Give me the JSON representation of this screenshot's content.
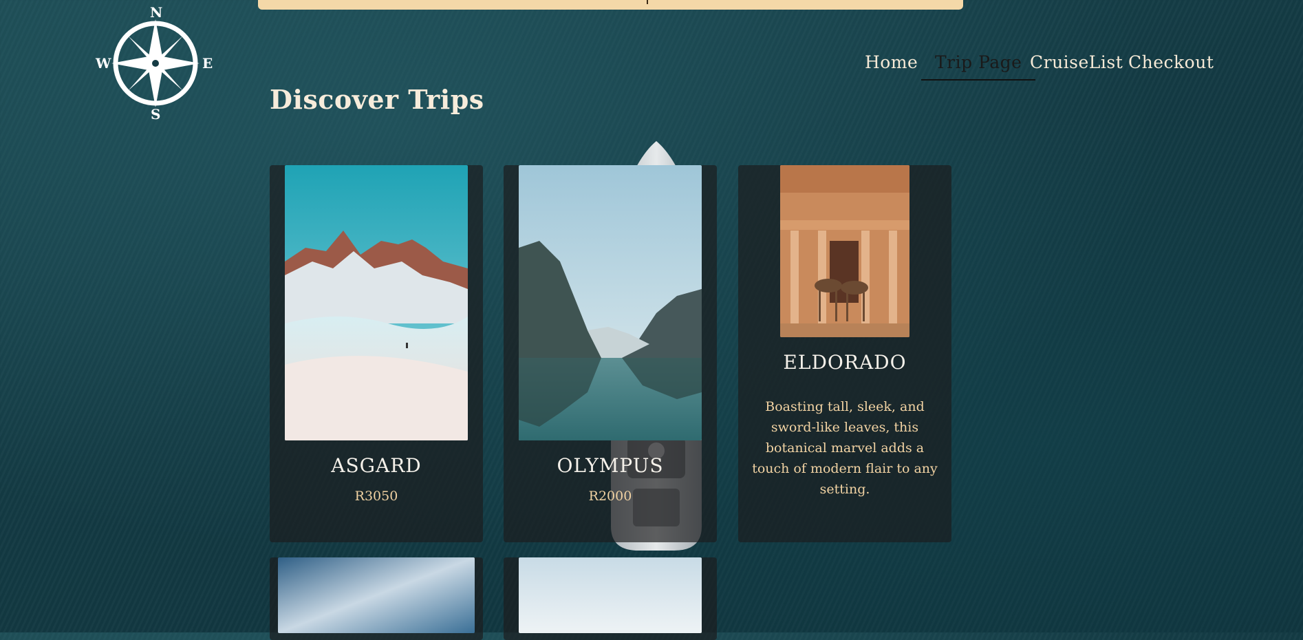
{
  "logo": {
    "n": "N",
    "s": "S",
    "e": "E",
    "w": "W"
  },
  "nav": {
    "items": [
      {
        "label": "Home",
        "active": false
      },
      {
        "label": "Trip Page",
        "active": true
      },
      {
        "label": "CruiseList",
        "active": false
      },
      {
        "label": "Checkout",
        "active": false
      }
    ]
  },
  "page": {
    "title": "Discover Trips"
  },
  "trips": [
    {
      "name": "ASGARD",
      "price": "R3050"
    },
    {
      "name": "OLYMPUS",
      "price": "R2000"
    },
    {
      "name": "ELDORADO",
      "description": "Boasting tall, sleek, and sword-like leaves, this botanical marvel adds a touch of modern flair to any setting."
    }
  ],
  "colors": {
    "accent": "#f4d8a8",
    "text_light": "#f6ead7",
    "price": "#f2d3a3"
  }
}
